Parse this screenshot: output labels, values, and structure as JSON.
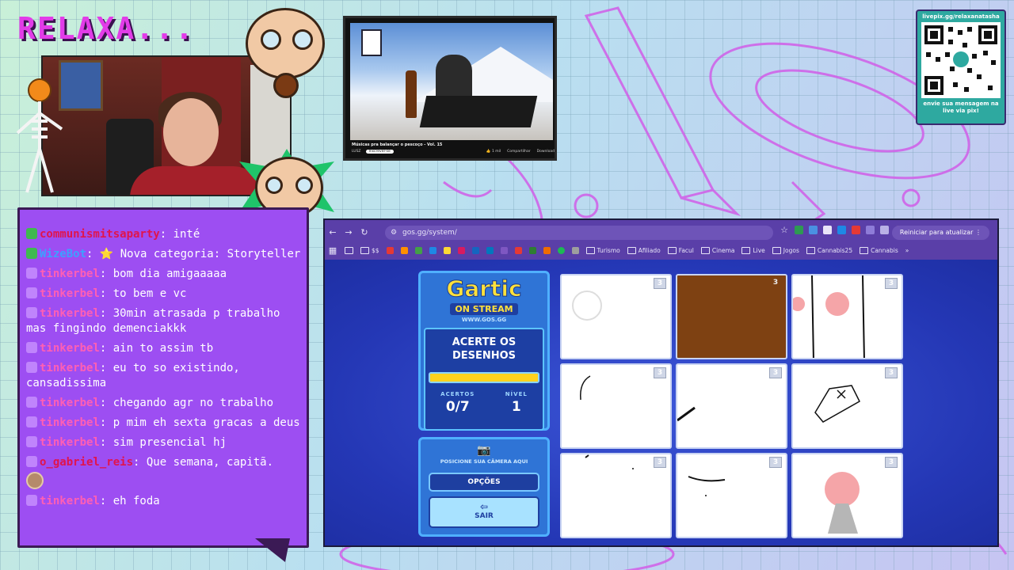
{
  "stream": {
    "title": "RELAXA..."
  },
  "video": {
    "title": "Músicas pra balançar o pescoço - Vol. 15",
    "channel": "LUSZ",
    "subscribe_label": "Inscrever-se",
    "likes": "1 mil",
    "share_label": "Compartilhar",
    "download_label": "Download"
  },
  "qr": {
    "url": "livepix.gg/relaxanatasha",
    "message": "envie sua mensagem na live via pix!"
  },
  "chat": {
    "messages": [
      {
        "user": "communismitsaparty",
        "sep": ": ",
        "text": "inté",
        "user_color": "#e0144c"
      },
      {
        "user": "WizeBot",
        "sep": ": ",
        "text": "⭐ Nova categoria: Storyteller",
        "user_color": "#3da0ff"
      },
      {
        "user": "tinkerbel",
        "sep": ": ",
        "text": "bom dia amigaaaaa",
        "user_color": "#ff5fb4"
      },
      {
        "user": "tinkerbel",
        "sep": ": ",
        "text": "to bem e vc",
        "user_color": "#ff5fb4"
      },
      {
        "user": "tinkerbel",
        "sep": ": ",
        "text": "30min atrasada p trabalho mas fingindo demenciakkk",
        "user_color": "#ff5fb4"
      },
      {
        "user": "tinkerbel",
        "sep": ": ",
        "text": "ain to assim tb",
        "user_color": "#ff5fb4"
      },
      {
        "user": "tinkerbel",
        "sep": ": ",
        "text": "eu to so existindo, cansadissima",
        "user_color": "#ff5fb4"
      },
      {
        "user": "tinkerbel",
        "sep": ": ",
        "text": "chegando agr no trabalho",
        "user_color": "#ff5fb4"
      },
      {
        "user": "tinkerbel",
        "sep": ": ",
        "text": "p mim eh sexta gracas a deus",
        "user_color": "#ff5fb4"
      },
      {
        "user": "tinkerbel",
        "sep": ": ",
        "text": "sim presencial hj",
        "user_color": "#ff5fb4"
      },
      {
        "user": "o_gabriel_reis",
        "sep": ": ",
        "text": "Que semana, capitã.",
        "user_color": "#e0144c"
      },
      {
        "user": "tinkerbel",
        "sep": ": ",
        "text": "eh foda",
        "user_color": "#ff5fb4"
      }
    ]
  },
  "browser": {
    "url": "gos.gg/system/",
    "update_label": "Reiniciar para atualizar",
    "bookmarks": [
      "$$",
      "Turismo",
      "Afiliado",
      "Facul",
      "Cinema",
      "Live",
      "Jogos",
      "Cannabis25",
      "Cannabis"
    ]
  },
  "gartic": {
    "logo_title": "Gartic",
    "logo_sub": "ON STREAM",
    "logo_url": "WWW.GOS.GG",
    "mission_title": "ACERTE OS DESENHOS",
    "progress_fraction": 1.0,
    "hits_label": "ACERTOS",
    "hits_value": "0/7",
    "level_label": "NÍVEL",
    "level_value": "1",
    "camera_label": "POSICIONE SUA CÂMERA AQUI",
    "options_label": "OPÇÕES",
    "exit_label": "SAIR",
    "tiles": [
      {
        "badge": "3"
      },
      {
        "badge": "3"
      },
      {
        "badge": "3"
      },
      {
        "badge": "3"
      },
      {
        "badge": "3"
      },
      {
        "badge": "3"
      },
      {
        "badge": "3"
      },
      {
        "badge": "3"
      },
      {
        "badge": "3"
      }
    ]
  },
  "colors": {
    "chat_bg": "#9d4ef2",
    "gartic_yellow": "#ffd21e",
    "browser_frame": "#5a3fa8",
    "accent_pink": "#e23ce8"
  }
}
